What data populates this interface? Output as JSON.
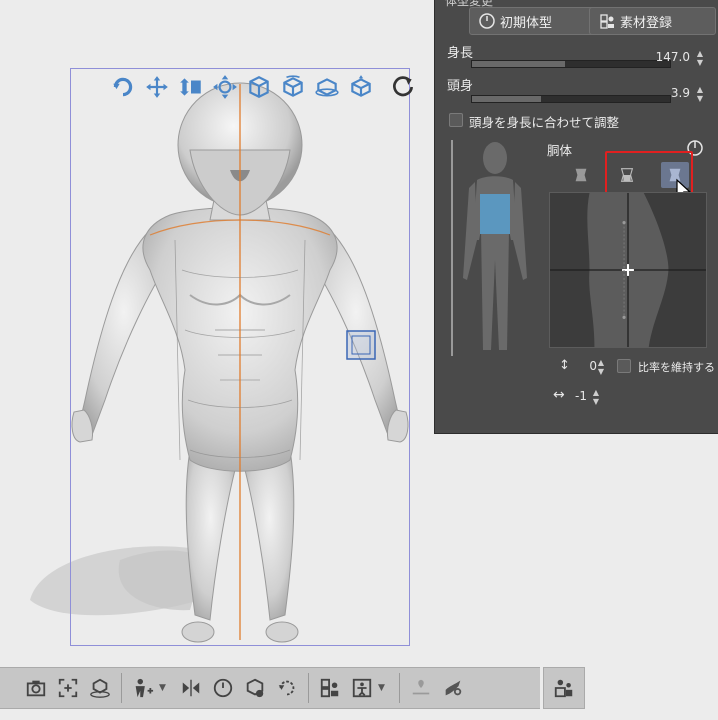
{
  "panel": {
    "header": "体型変更",
    "initial_shape_label": "初期体型",
    "register_material_label": "素材登録",
    "height_label": "身長",
    "height_value": "147.0",
    "height_fill": 0.47,
    "head_label": "頭身",
    "head_value": "3.9",
    "head_fill": 0.35,
    "adjust_head_label": "頭身を身長に合わせて調整",
    "part_label": "胴体",
    "vertical_value": "0",
    "keep_ratio_label": "比率を維持する",
    "horizontal_value": "-1",
    "vertical_arrow": "↕",
    "horizontal_arrow": "↔"
  },
  "colors": {
    "panel_bg": "#4a4a4a",
    "accent_blue": "#4a86c8",
    "highlight_red": "#e12020",
    "torso_highlight": "#5b97bf",
    "frame": "#8f8fd8",
    "guide_orange": "#e07a2a"
  },
  "canvas_tools": [
    "rotate-icon",
    "pan-icon",
    "move-depth-icon",
    "gizmo-move-icon",
    "gizmo-rotate-icon",
    "gizmo-rotate2-icon",
    "gizmo-plane-icon",
    "gizmo-scale-icon",
    "reset-view-icon"
  ],
  "toolbar": [
    "camera-icon",
    "fit-frame-icon",
    "floor-icon",
    "add-pose-icon",
    "flip-icon",
    "reset-icon",
    "material-icon",
    "rotate-reset-icon",
    "register-icon",
    "pose-icon",
    "rig-icon",
    "hand-icon",
    "person-icon"
  ]
}
